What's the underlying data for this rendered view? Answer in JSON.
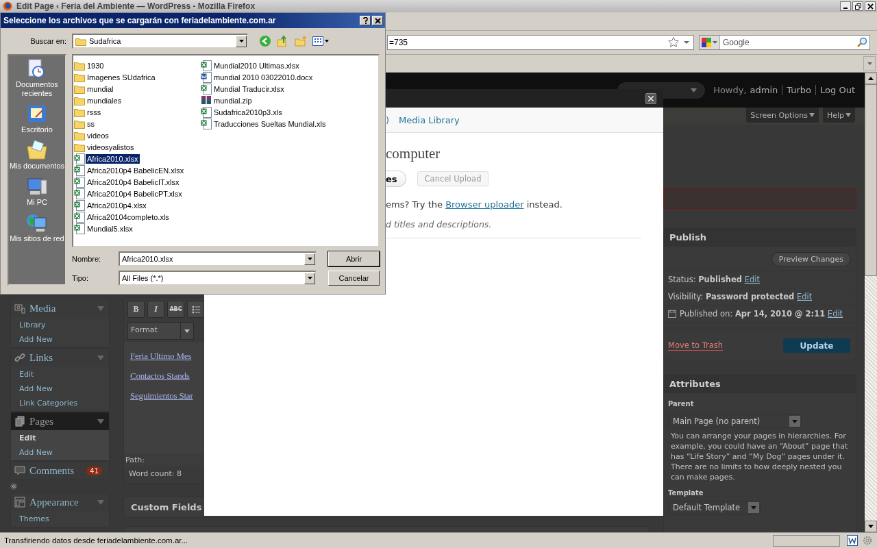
{
  "browser": {
    "title": "Edit Page ‹ Feria del Ambiente — WordPress - Mozilla Firefox",
    "url": "=735",
    "search_placeholder": "Google",
    "status": "Transfiriendo datos desde feriadelambiente.com.ar..."
  },
  "wp": {
    "header": {
      "greeting": "Howdy,",
      "links": [
        "admin",
        "Turbo",
        "Log Out"
      ]
    },
    "screen_buttons": [
      "Screen Options",
      "Help"
    ],
    "menu": [
      {
        "label": "Media",
        "current": false,
        "children": [
          {
            "label": "Library",
            "current": false
          },
          {
            "label": "Add New",
            "current": false
          }
        ]
      },
      {
        "label": "Links",
        "current": false,
        "children": [
          {
            "label": "Edit",
            "current": false
          },
          {
            "label": "Add New",
            "current": false
          },
          {
            "label": "Link Categories",
            "current": false
          }
        ]
      },
      {
        "label": "Pages",
        "current": true,
        "children": [
          {
            "label": "Edit",
            "current": true
          },
          {
            "label": "Add New",
            "current": false
          }
        ]
      },
      {
        "label": "Comments",
        "current": false,
        "badge": "41",
        "collapse_after": true
      },
      {
        "label": "Appearance",
        "current": false,
        "children": [
          {
            "label": "Themes",
            "current": false
          }
        ]
      }
    ],
    "editor": {
      "toolbar": [
        "B",
        "I",
        "ABC"
      ],
      "format": "Format",
      "links": [
        "Feria Ultimo Mes",
        "Contactos Stands",
        "Seguimientos Star"
      ],
      "path": "Path:",
      "word_count": "Word count: 8"
    },
    "boxes": [
      "Custom Fields"
    ],
    "publish": {
      "title": "Publish",
      "preview": "Preview Changes",
      "rows": [
        {
          "kind": "plain",
          "text": "Status: **Published**",
          "link": "Edit"
        },
        {
          "kind": "plain",
          "text": "Visibility: **Password protected**",
          "link": "Edit"
        },
        {
          "kind": "date",
          "text": "Published on: **Apr 14, 2010 @ 2:11**",
          "link": "Edit"
        }
      ],
      "trash": "Move to Trash",
      "update": "Update"
    },
    "attributes": {
      "title": "Attributes",
      "parent_label": "Parent",
      "parent": "Main Page (no parent)",
      "help": "You can arrange your pages in hierarchies. For example, you could have an “About” page that has “Life Story” and “My Dog” pages under it. There are no limits to how deeply nested you can make pages.",
      "template_label": "Template",
      "template": "Default Template"
    }
  },
  "modal": {
    "tab_fragment": ")",
    "tab": "Media Library",
    "heading": "computer",
    "select_button": "es",
    "cancel_button": "Cancel Upload",
    "cancel_disabled": true,
    "note_before": "ems? Try the",
    "note_link": "Browser uploader",
    "note_after": "instead.",
    "hint": "d titles and descriptions."
  },
  "dialog": {
    "title": "Seleccione los archivos que se cargarán con feriadelambiente.com.ar",
    "look_in_label": "Buscar en:",
    "look_in": "Sudafrica",
    "places": [
      {
        "label": "Documentos recientes"
      },
      {
        "label": "Escritorio"
      },
      {
        "label": "Mis documentos"
      },
      {
        "label": "Mi PC"
      },
      {
        "label": "Mis sitios de red"
      }
    ],
    "files": [
      {
        "name": "1930",
        "kind": "folder",
        "selected": false
      },
      {
        "name": "Imagenes SUdafrica",
        "kind": "folder",
        "selected": false
      },
      {
        "name": "mundial",
        "kind": "folder",
        "selected": false
      },
      {
        "name": "mundiales",
        "kind": "folder",
        "selected": false
      },
      {
        "name": "rsss",
        "kind": "folder",
        "selected": false
      },
      {
        "name": "ss",
        "kind": "folder",
        "selected": false
      },
      {
        "name": "videos",
        "kind": "folder",
        "selected": false
      },
      {
        "name": "videosyalistos",
        "kind": "folder",
        "selected": false
      },
      {
        "name": "Africa2010.xlsx",
        "kind": "sheet",
        "selected": true
      },
      {
        "name": "Africa2010p4 BabelicEN.xlsx",
        "kind": "sheet",
        "selected": false
      },
      {
        "name": "Africa2010p4 BabelicIT.xlsx",
        "kind": "sheet",
        "selected": false
      },
      {
        "name": "Africa2010p4 BabelicPT.xlsx",
        "kind": "sheet",
        "selected": false
      },
      {
        "name": "Africa2010p4.xlsx",
        "kind": "sheet",
        "selected": false
      },
      {
        "name": "Africa20104completo.xls",
        "kind": "sheet",
        "selected": false
      },
      {
        "name": "Mundial5.xlsx",
        "kind": "sheet",
        "selected": false
      },
      {
        "name": "Mundial2010 Ultimas.xlsx",
        "kind": "sheet",
        "selected": false
      },
      {
        "name": "mundial 2010 03022010.docx",
        "kind": "doc",
        "selected": false
      },
      {
        "name": "Mundial Traducir.xlsx",
        "kind": "sheet",
        "selected": false
      },
      {
        "name": "mundial.zip",
        "kind": "zip",
        "selected": false
      },
      {
        "name": "Sudafrica2010p3.xls",
        "kind": "sheet",
        "selected": false
      },
      {
        "name": "Traducciones Sueltas Mundial.xls",
        "kind": "sheet",
        "selected": false
      }
    ],
    "name_label": "Nombre:",
    "name_value": "Africa2010.xlsx",
    "type_label": "Tipo:",
    "type_value": "All Files (*.*)",
    "open": "Abrir",
    "cancel": "Cancelar"
  }
}
